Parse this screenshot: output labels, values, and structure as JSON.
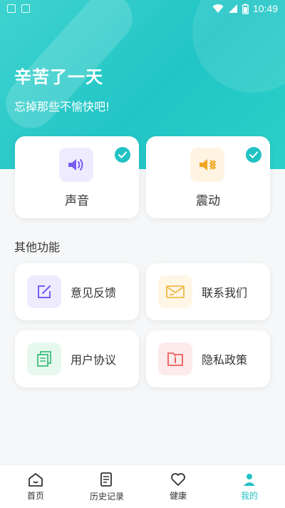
{
  "status_bar": {
    "time": "10:49"
  },
  "hero": {
    "title": "辛苦了一天",
    "subtitle": "忘掉那些不愉快吧!"
  },
  "modes": [
    {
      "label": "声音",
      "icon": "speaker-icon",
      "selected": true,
      "color": "#7b5cf0",
      "bg": "#efebff"
    },
    {
      "label": "震动",
      "icon": "vibrate-icon",
      "selected": true,
      "color": "#f0a623",
      "bg": "#fff4e2"
    }
  ],
  "section": {
    "title": "其他功能"
  },
  "functions": [
    {
      "label": "意见反馈",
      "icon": "feedback-icon",
      "color": "#7b5cf0",
      "bg": "#efebff"
    },
    {
      "label": "联系我们",
      "icon": "mail-icon",
      "color": "#f0b94a",
      "bg": "#fff6e5"
    },
    {
      "label": "用户协议",
      "icon": "agreement-icon",
      "color": "#3fbf7f",
      "bg": "#e7f8ef"
    },
    {
      "label": "隐私政策",
      "icon": "privacy-icon",
      "color": "#ec5d5d",
      "bg": "#fdeaea"
    }
  ],
  "tabbar": {
    "items": [
      {
        "label": "首页",
        "icon": "home-icon",
        "active": false
      },
      {
        "label": "历史记录",
        "icon": "history-icon",
        "active": false
      },
      {
        "label": "健康",
        "icon": "health-icon",
        "active": false
      },
      {
        "label": "我的",
        "icon": "profile-icon",
        "active": true
      }
    ]
  },
  "colors": {
    "accent": "#22c2c4"
  }
}
